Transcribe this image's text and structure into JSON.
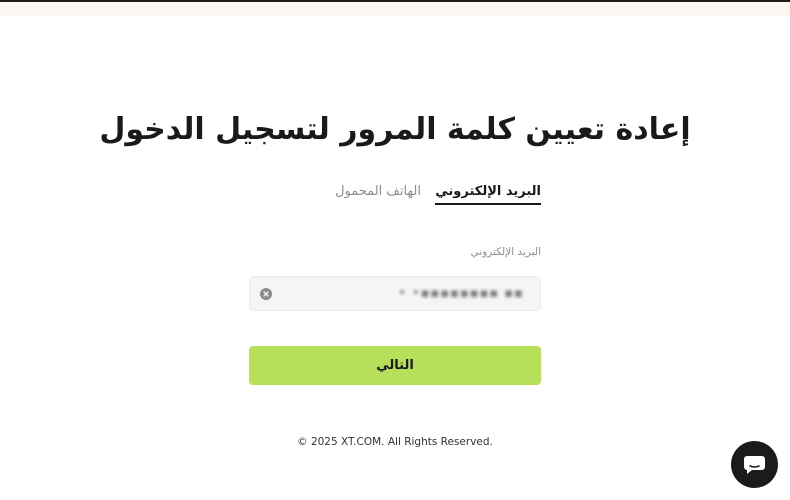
{
  "header": {
    "title": "إعادة تعيين كلمة المرور لتسجيل الدخول"
  },
  "tabs": [
    {
      "label": "البريد الإلكتروني",
      "active": true
    },
    {
      "label": "الهاتف المحمول",
      "active": false
    }
  ],
  "form": {
    "email_label": "البريد الإلكتروني",
    "email_value": "• •▪▪▪▪▪▪▪▪ ▪▪",
    "clear_icon": "clear-circle-icon",
    "next_label": "التالي"
  },
  "footer": {
    "copyright": "© 2025 XT.COM. All Rights Reserved."
  },
  "chat": {
    "icon": "chat-bubble-icon"
  },
  "colors": {
    "accent": "#b6e05a",
    "text": "#1a1a1a",
    "muted": "#8d8d8d",
    "input_bg": "#f6f5f3",
    "chat_bg": "#1b1b1b"
  }
}
